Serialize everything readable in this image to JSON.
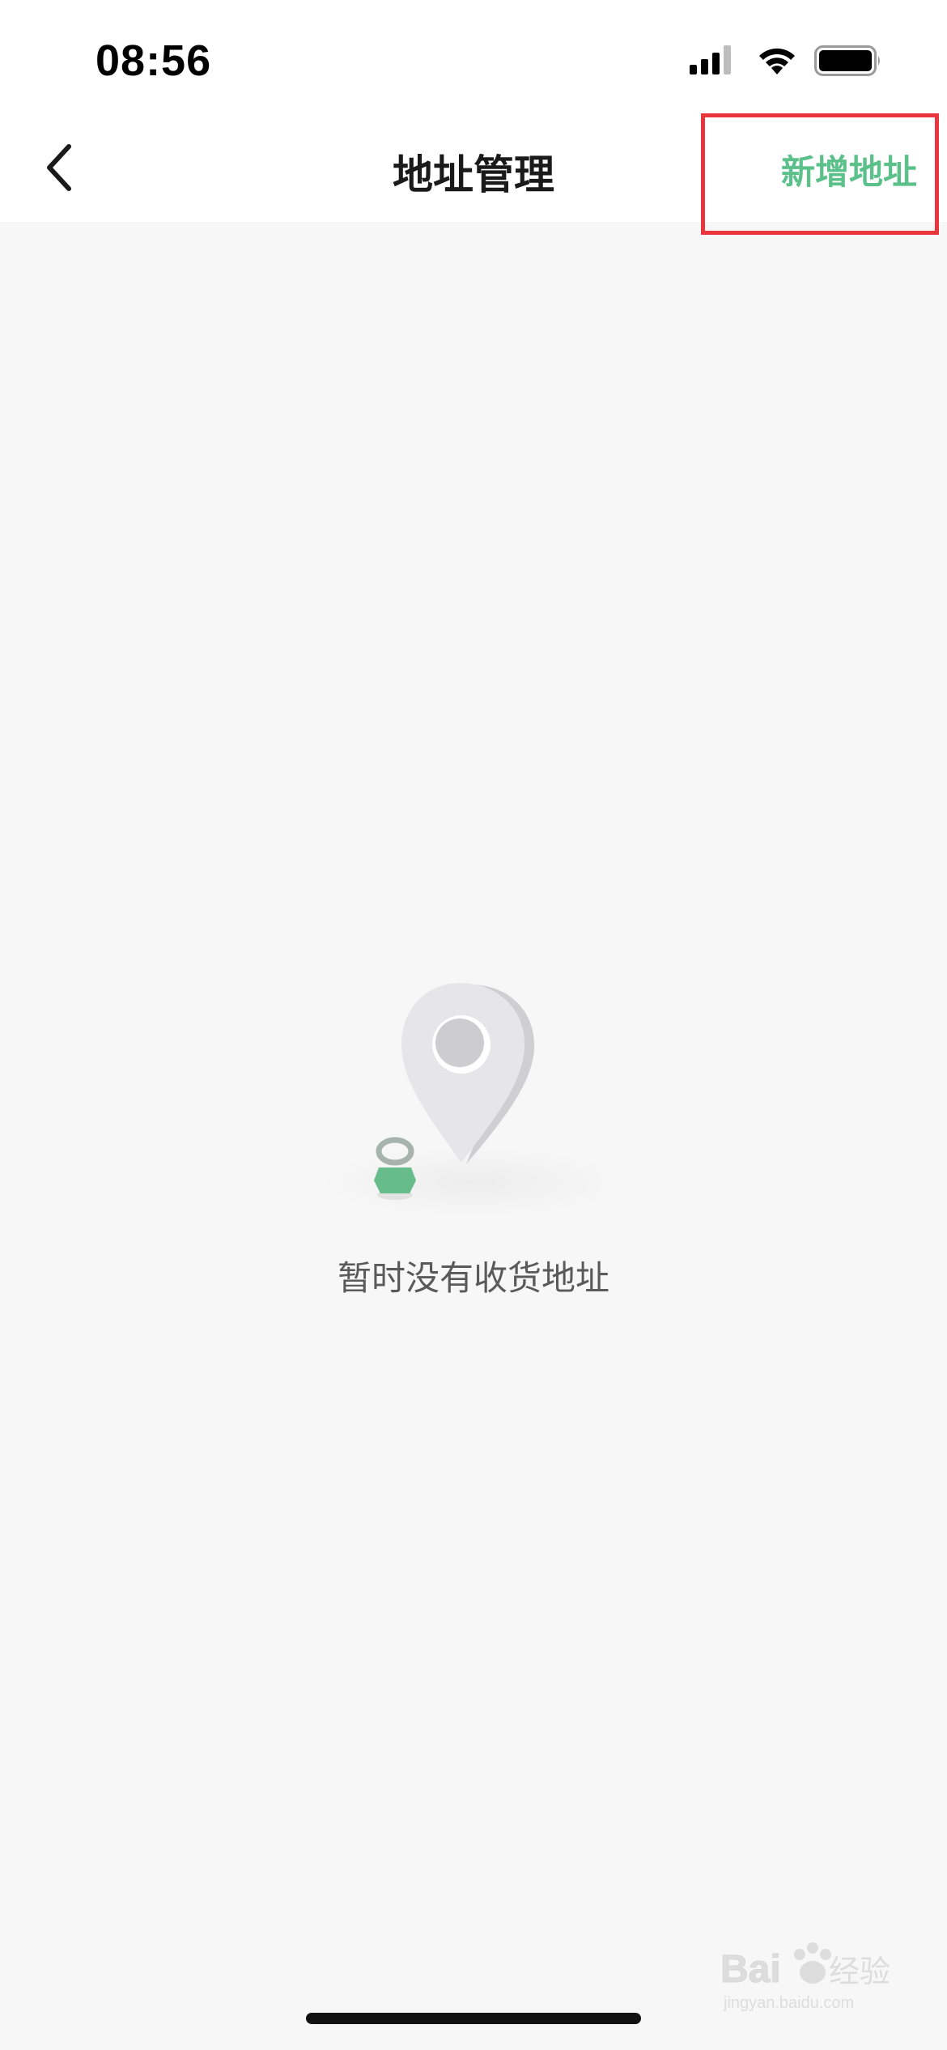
{
  "status_bar": {
    "time": "08:56",
    "icons": [
      "signal-icon",
      "wifi-icon",
      "battery-icon"
    ]
  },
  "nav": {
    "back_icon": "chevron-left-icon",
    "title": "地址管理",
    "add_label": "新增地址"
  },
  "empty_state": {
    "icon": "location-pin-icon",
    "message": "暂时没有收货地址"
  },
  "watermark": {
    "logo": "baidu-jingyan-logo",
    "text": "jingyan.baidu.com"
  },
  "colors": {
    "accent_green": "#5cc08a",
    "highlight_red": "#e8363c",
    "background": "#f7f7f7",
    "title_text": "#1a1a1a"
  }
}
